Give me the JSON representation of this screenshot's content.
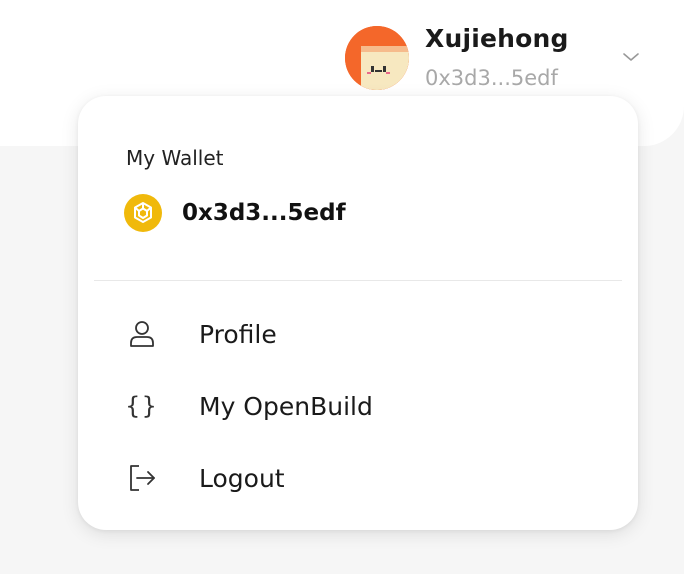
{
  "header": {
    "user_name": "Xujiehong",
    "user_address": "0x3d3...5edf",
    "avatar_icon": "avatar-face-icon",
    "dropdown_icon": "chevron-down-icon"
  },
  "wallet": {
    "title": "My Wallet",
    "address": "0x3d3...5edf",
    "chain_icon": "bnb-icon",
    "chain_color": "#f0b90b"
  },
  "menu": {
    "items": [
      {
        "label": "Profile",
        "icon": "user-icon"
      },
      {
        "label": "My OpenBuild",
        "icon": "braces-icon"
      },
      {
        "label": "Logout",
        "icon": "logout-icon"
      }
    ]
  },
  "colors": {
    "avatar_bg": "#f4672a",
    "avatar_face": "#f7e8c0",
    "muted_text": "#a8a8a8"
  }
}
